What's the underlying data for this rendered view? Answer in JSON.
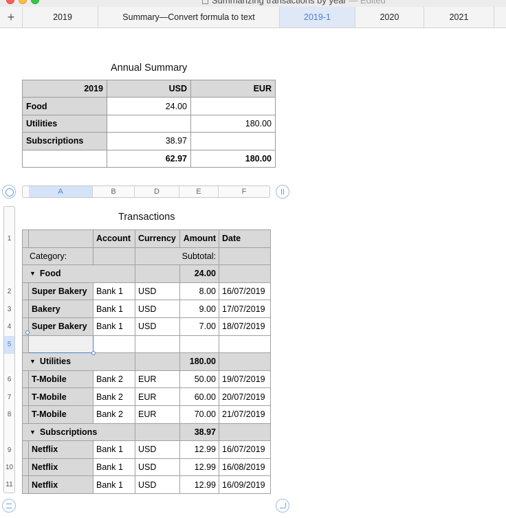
{
  "window": {
    "title": "Summarizing transactions by year",
    "status": "— Edited"
  },
  "tabs": [
    {
      "label": "2019"
    },
    {
      "label": "Summary—Convert formula to text"
    },
    {
      "label": "2019-1"
    },
    {
      "label": "2020"
    },
    {
      "label": "2021"
    }
  ],
  "active_tab": "2019-1",
  "summary": {
    "title": "Annual Summary",
    "headers": [
      "2019",
      "USD",
      "EUR"
    ],
    "rows": [
      {
        "label": "Food",
        "usd": "24.00",
        "eur": ""
      },
      {
        "label": "Utilities",
        "usd": "",
        "eur": "180.00"
      },
      {
        "label": "Subscriptions",
        "usd": "38.97",
        "eur": ""
      }
    ],
    "total": {
      "label": "",
      "usd": "62.97",
      "eur": "180.00"
    }
  },
  "column_letters": [
    "A",
    "B",
    "D",
    "E",
    "F"
  ],
  "selected_column": "A",
  "row_numbers": [
    "1",
    "",
    "",
    "2",
    "3",
    "4",
    "5",
    "",
    "6",
    "7",
    "8",
    "",
    "9",
    "10",
    "11"
  ],
  "selected_row": "5",
  "transactions": {
    "title": "Transactions",
    "headers": [
      "",
      "Account",
      "Currency",
      "Amount",
      "Date"
    ],
    "category_label": "Category:",
    "subtotal_label": "Subtotal:",
    "groups": [
      {
        "name": "Food",
        "subtotal": "24.00",
        "rows": [
          {
            "name": "Super Bakery",
            "account": "Bank 1",
            "currency": "USD",
            "amount": "8.00",
            "date": "16/07/2019"
          },
          {
            "name": "Bakery",
            "account": "Bank 1",
            "currency": "USD",
            "amount": "9.00",
            "date": "17/07/2019"
          },
          {
            "name": "Super Bakery",
            "account": "Bank 1",
            "currency": "USD",
            "amount": "7.00",
            "date": "18/07/2019"
          },
          {
            "name": "",
            "account": "",
            "currency": "",
            "amount": "",
            "date": ""
          }
        ]
      },
      {
        "name": "Utilities",
        "subtotal": "180.00",
        "rows": [
          {
            "name": "T-Mobile",
            "account": "Bank 2",
            "currency": "EUR",
            "amount": "50.00",
            "date": "19/07/2019"
          },
          {
            "name": "T-Mobile",
            "account": "Bank 2",
            "currency": "EUR",
            "amount": "60.00",
            "date": "20/07/2019"
          },
          {
            "name": "T-Mobile",
            "account": "Bank 2",
            "currency": "EUR",
            "amount": "70.00",
            "date": "21/07/2019"
          }
        ]
      },
      {
        "name": "Subscriptions",
        "subtotal": "38.97",
        "rows": [
          {
            "name": "Netflix",
            "account": "Bank 1",
            "currency": "USD",
            "amount": "12.99",
            "date": "16/07/2019"
          },
          {
            "name": "Netflix",
            "account": "Bank 1",
            "currency": "USD",
            "amount": "12.99",
            "date": "16/08/2019"
          },
          {
            "name": "Netflix",
            "account": "Bank 1",
            "currency": "USD",
            "amount": "12.99",
            "date": "16/09/2019"
          }
        ]
      }
    ]
  }
}
